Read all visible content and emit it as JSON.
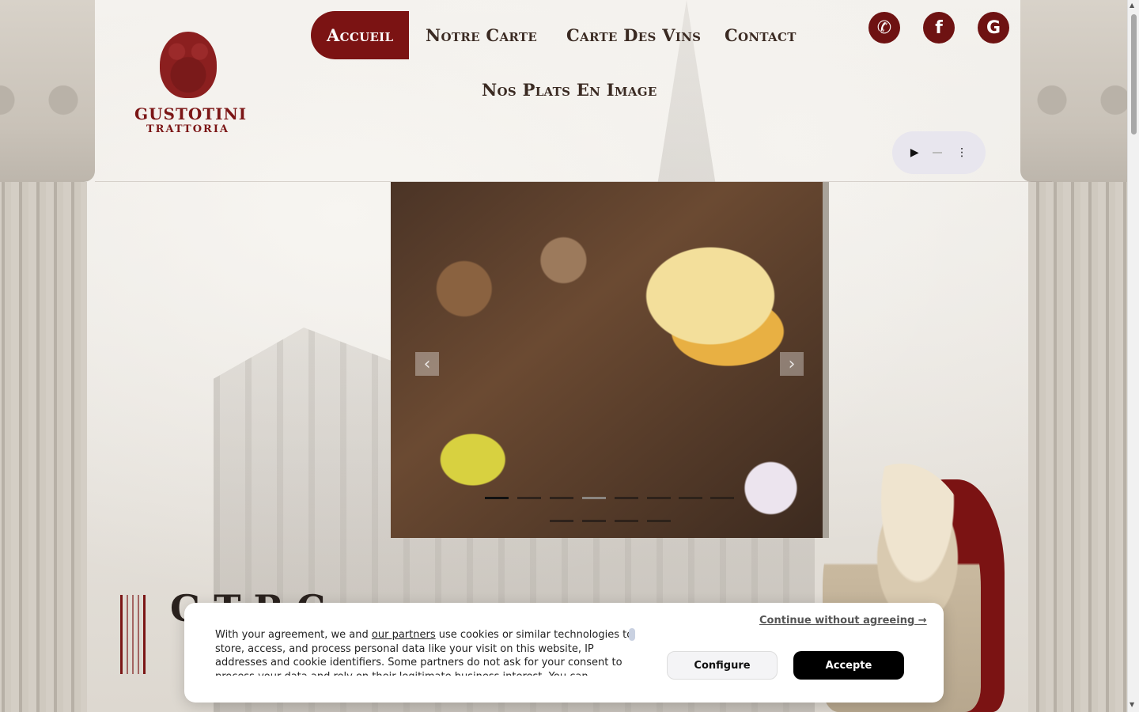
{
  "brand": {
    "name": "GUSTOTINI",
    "subtitle": "TRATTORIA"
  },
  "nav": {
    "items": [
      {
        "label": "Accueil",
        "active": true
      },
      {
        "label": "Notre Carte",
        "active": false
      },
      {
        "label": "Carte Des Vins",
        "active": false
      },
      {
        "label": "Contact",
        "active": false
      },
      {
        "label": "Nos Plats En Image",
        "active": false
      }
    ]
  },
  "social": {
    "icons": [
      "phone-icon",
      "facebook-icon",
      "google-icon"
    ]
  },
  "audio_player": {
    "play_glyph": "▶",
    "menu_glyph": "⋮"
  },
  "slider": {
    "prev_glyph": "‹",
    "next_glyph": "›",
    "dot_count_row1": 8,
    "dot_count_row2": 4,
    "active_index": 0
  },
  "section": {
    "title": "G T R C"
  },
  "cookie": {
    "text_before_link": "With your agreement, we and ",
    "link": "our partners",
    "text_after_link": " use cookies or similar technologies to store, access, and process personal data like your visit on this website, IP addresses and cookie identifiers. Some partners do not ask for your consent to process your data and rely on their legitimate business interest. You can",
    "continue_label": "Continue without agreeing →",
    "configure_label": "Configure",
    "accept_label": "Accepte"
  },
  "colors": {
    "accent": "#7b1313",
    "background": "#ece9e3"
  }
}
